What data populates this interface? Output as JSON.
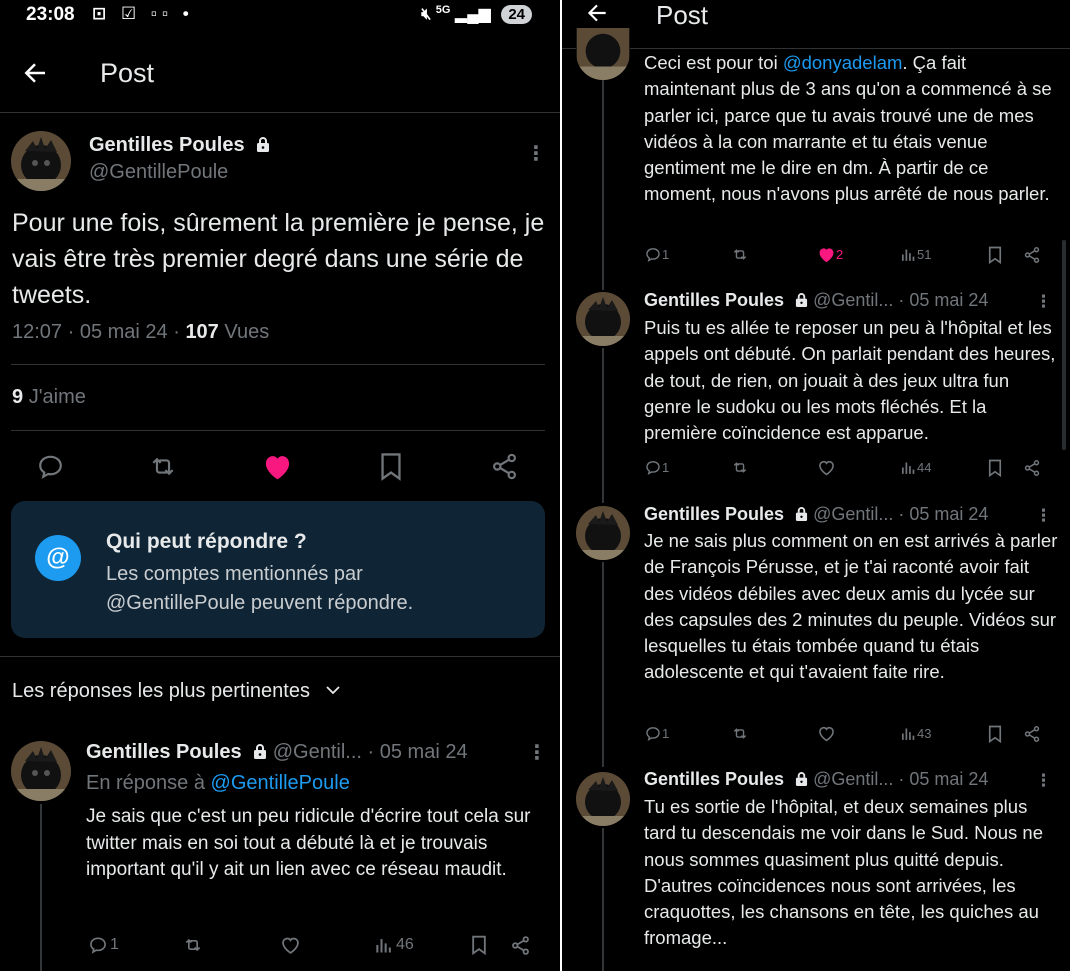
{
  "status_bar": {
    "time": "23:08",
    "icons": "⊡ ☑ ▫▫ •",
    "net": "5G",
    "battery": "24"
  },
  "header": {
    "title": "Post"
  },
  "main_post": {
    "author_name": "Gentilles Poules",
    "author_handle": "@GentillePoule",
    "text": "Pour une fois, sûrement la première je pense, je vais être très premier degré dans une série de tweets.",
    "time": "12:07 · 05 mai 24 ·",
    "views_count": "107",
    "views_label": "Vues",
    "likes_count": "9",
    "likes_label": "J'aime"
  },
  "reply_restriction": {
    "title": "Qui peut répondre ?",
    "body": "Les comptes mentionnés par @GentillePoule peuvent répondre."
  },
  "replies_sort": {
    "label": "Les réponses les plus pertinentes"
  },
  "left_reply": {
    "author_name": "Gentilles Poules",
    "author_handle": "@Gentil...",
    "date": "· 05 mai 24",
    "in_reply_prefix": "En réponse à",
    "in_reply_handle": "@GentillePoule",
    "text": "Je sais que c'est un peu ridicule d'écrire tout cela sur twitter mais en soi tout a débuté là et je trouvais important qu'il y ait un lien avec ce réseau maudit.",
    "replies": "1",
    "views": "46"
  },
  "right_posts": [
    {
      "text_before": "Ceci est pour toi",
      "mention": "@donyadelam",
      "text_after": ". Ça fait maintenant plus de 3 ans qu'on a commencé à se parler ici, parce que tu avais trouvé une de mes vidéos à la con marrante et tu étais venue gentiment me le dire en dm. À partir de ce moment, nous n'avons plus arrêté de nous parler.",
      "replies": "1",
      "likes": "2",
      "views": "51"
    },
    {
      "author_name": "Gentilles Poules",
      "author_handle": "@Gentil...",
      "date": "· 05 mai 24",
      "text": "Puis tu es allée te reposer un peu à l'hôpital et les appels ont débuté. On parlait pendant des heures, de tout, de rien, on jouait à des jeux ultra fun genre le sudoku ou les mots fléchés. Et la première coïncidence est apparue.",
      "replies": "1",
      "views": "44"
    },
    {
      "author_name": "Gentilles Poules",
      "author_handle": "@Gentil...",
      "date": "· 05 mai 24",
      "text": "Je ne sais plus comment on en est arrivés à parler de François Pérusse, et je t'ai raconté avoir fait des vidéos débiles avec deux amis du lycée sur des capsules des 2 minutes du peuple. Vidéos sur lesquelles tu étais tombée quand tu étais adolescente et qui t'avaient faite rire.",
      "replies": "1",
      "views": "43"
    },
    {
      "author_name": "Gentilles Poules",
      "author_handle": "@Gentil...",
      "date": "· 05 mai 24",
      "text": "Tu es sortie de l'hôpital, et deux semaines plus tard tu descendais me voir dans le Sud. Nous ne nous sommes quasiment plus quitté depuis. D'autres coïncidences nous sont arrivées, les craquottes, les chansons en tête, les quiches au fromage..."
    }
  ],
  "colors": {
    "background": "#000000",
    "text": "#e7e9ea",
    "muted": "#71767b",
    "like": "#f91880",
    "accent": "#1d9bf0",
    "card": "#0f2535"
  }
}
